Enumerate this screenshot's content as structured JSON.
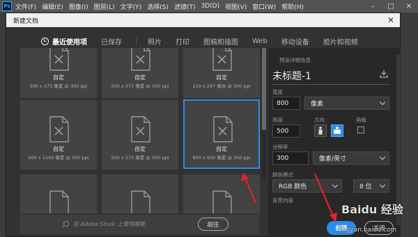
{
  "app": {
    "logo": "Ps",
    "menus": [
      "文件(F)",
      "编辑(E)",
      "图像(I)",
      "图层(L)",
      "文字(Y)",
      "选择(S)",
      "滤镜(T)",
      "3D(D)",
      "视图(V)",
      "窗口(W)",
      "帮助(H)"
    ],
    "minimize_icon": "minimize-icon",
    "maximize_icon": "maximize-icon",
    "close_icon": "close-icon"
  },
  "dialog": {
    "title": "新建文档",
    "close_symbol": "✕",
    "tabs": [
      "最近使用项",
      "已保存",
      "照片",
      "打印",
      "图稿和插图",
      "Web",
      "移动设备",
      "胶片和视频"
    ],
    "active_tab": "最近使用项"
  },
  "presets": [
    {
      "name": "自定",
      "dims": "500 x 375 像素 @ 300 ppi"
    },
    {
      "name": "自定",
      "dims": "500 x 375 像素 @ 300 ppi"
    },
    {
      "name": "自定",
      "dims": "210 x 297 毫米 @ 300 ppi"
    },
    {
      "name": "自定",
      "dims": "500 x 1200 像素 @ 300 ppi"
    },
    {
      "name": "自定",
      "dims": "500 x 375 像素 @ 300 ppi"
    },
    {
      "name": "自定",
      "dims": "800 x 500 像素 @ 300 ppi",
      "selected": true
    },
    {
      "name": "",
      "dims": ""
    },
    {
      "name": "",
      "dims": ""
    },
    {
      "name": "",
      "dims": ""
    }
  ],
  "stock": {
    "placeholder": "在 Adobe Stock 上查找模板",
    "go_label": "前往"
  },
  "details": {
    "section_title": "预设详细信息",
    "doc_name": "未标题-1",
    "width_label": "宽度",
    "width_value": "800",
    "width_unit": "像素",
    "height_label": "高度",
    "height_value": "500",
    "orientation_label": "方向",
    "artboard_label": "画板",
    "resolution_label": "分辨率",
    "resolution_value": "300",
    "resolution_unit": "像素/英寸",
    "color_mode_label": "颜色模式",
    "color_mode_value": "RGB 颜色",
    "bit_depth_value": "8 位",
    "background_label": "背景内容"
  },
  "buttons": {
    "create": "创建",
    "close": "关闭"
  },
  "watermark": {
    "text": "Baidu 经验",
    "url": "jingyan.baidu.com"
  },
  "colors": {
    "accent": "#2d8ceb",
    "annotation": "#e0242b"
  }
}
